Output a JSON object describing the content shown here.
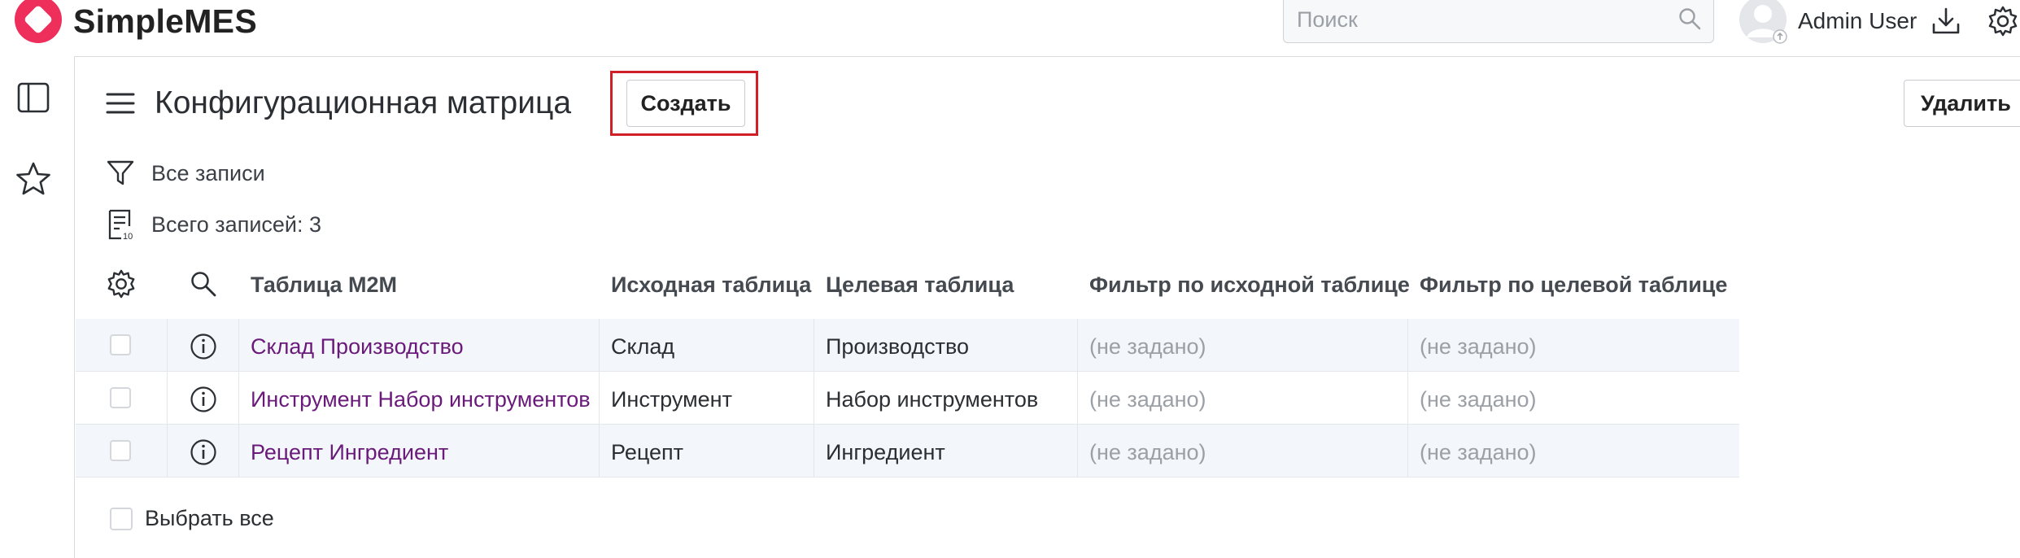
{
  "app": {
    "name": "SimpleMES"
  },
  "header": {
    "search_placeholder": "Поиск",
    "user_name": "Admin User",
    "icons": {
      "download": "download-icon",
      "settings": "gear-icon",
      "search": "search-icon",
      "avatar": "avatar"
    }
  },
  "sidebar": {
    "icons": [
      "panel-toggle-icon",
      "star-icon"
    ]
  },
  "page": {
    "title": "Конфигурационная матрица",
    "create_label": "Создать",
    "delete_label": "Удалить",
    "filter_label": "Все записи",
    "record_count": "Всего записей: 3"
  },
  "table": {
    "columns": [
      "Таблица M2M",
      "Исходная таблица",
      "Целевая таблица",
      "Фильтр по исходной таблице",
      "Фильтр по целевой таблице"
    ],
    "rows": [
      {
        "m2m": "Склад Производство",
        "source": "Склад",
        "target": "Производство",
        "source_filter": "(не задано)",
        "target_filter": "(не задано)"
      },
      {
        "m2m": "Инструмент Набор инструментов",
        "source": "Инструмент",
        "target": "Набор инструментов",
        "source_filter": "(не задано)",
        "target_filter": "(не задано)"
      },
      {
        "m2m": "Рецепт Ингредиент",
        "source": "Рецепт",
        "target": "Ингредиент",
        "source_filter": "(не задано)",
        "target_filter": "(не задано)"
      }
    ],
    "select_all_label": "Выбрать все"
  },
  "colors": {
    "accent": "#ee2e5b",
    "link": "#6a1a7a",
    "highlight": "#d01f26",
    "row_alt": "#f3f6fa"
  }
}
